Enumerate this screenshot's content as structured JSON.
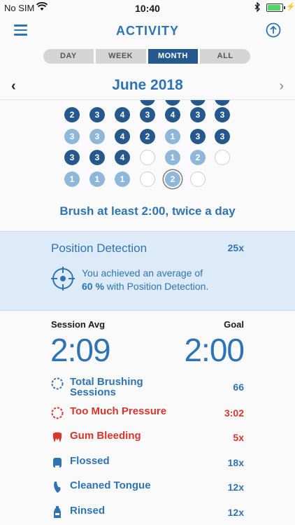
{
  "status": {
    "carrier": "No SIM",
    "time": "10:40"
  },
  "header": {
    "title": "ACTIVITY"
  },
  "segments": [
    {
      "label": "DAY",
      "active": false
    },
    {
      "label": "WEEK",
      "active": false
    },
    {
      "label": "MONTH",
      "active": true
    },
    {
      "label": "ALL",
      "active": false
    }
  ],
  "month": {
    "label": "June 2018",
    "prev": "‹",
    "next": "›"
  },
  "calendar": {
    "rows": [
      [
        {
          "v": "2",
          "s": "dark"
        },
        {
          "v": "3",
          "s": "dark"
        },
        {
          "v": "4",
          "s": "dark"
        },
        {
          "v": "3",
          "s": "dark"
        },
        {
          "v": "4",
          "s": "dark"
        },
        {
          "v": "3",
          "s": "dark"
        },
        {
          "v": "3",
          "s": "dark"
        }
      ],
      [
        {
          "v": "3",
          "s": "light"
        },
        {
          "v": "3",
          "s": "light"
        },
        {
          "v": "4",
          "s": "dark"
        },
        {
          "v": "2",
          "s": "dark"
        },
        {
          "v": "1",
          "s": "light"
        },
        {
          "v": "3",
          "s": "dark"
        },
        {
          "v": "3",
          "s": "dark"
        }
      ],
      [
        {
          "v": "3",
          "s": "dark"
        },
        {
          "v": "3",
          "s": "dark"
        },
        {
          "v": "4",
          "s": "dark"
        },
        {
          "v": "",
          "s": "empty"
        },
        {
          "v": "1",
          "s": "light"
        },
        {
          "v": "2",
          "s": "light"
        },
        {
          "v": "",
          "s": "empty"
        }
      ],
      [
        {
          "v": "1",
          "s": "light"
        },
        {
          "v": "1",
          "s": "light"
        },
        {
          "v": "1",
          "s": "light"
        },
        {
          "v": "",
          "s": "empty"
        },
        {
          "v": "2",
          "s": "light",
          "today": true
        },
        {
          "v": "",
          "s": "empty"
        }
      ]
    ]
  },
  "goal_text": "Brush at least 2:00, twice a day",
  "position": {
    "title": "Position Detection",
    "count": "25x",
    "msg_line1": "You achieved an average of",
    "msg_percent": "60 %",
    "msg_line2": " with Position Detection."
  },
  "stats": {
    "avg_label": "Session Avg",
    "goal_label": "Goal",
    "avg_time": "2:09",
    "goal_time": "2:00"
  },
  "rows": [
    {
      "icon": "dashed-circle-icon",
      "label1": "Total Brushing",
      "label2": "Sessions",
      "value": "66",
      "red": false
    },
    {
      "icon": "pressure-circle-icon",
      "label1": "Too Much Pressure",
      "label2": "",
      "value": "3:02",
      "red": true
    },
    {
      "icon": "tooth-drop-icon",
      "label1": "Gum Bleeding",
      "label2": "",
      "value": "5x",
      "red": true
    },
    {
      "icon": "floss-icon",
      "label1": "Flossed",
      "label2": "",
      "value": "18x",
      "red": false
    },
    {
      "icon": "tongue-icon",
      "label1": "Cleaned Tongue",
      "label2": "",
      "value": "12x",
      "red": false
    },
    {
      "icon": "mouthwash-icon",
      "label1": "Rinsed",
      "label2": "",
      "value": "12x",
      "red": false
    }
  ],
  "colors": {
    "primary": "#2e74b5",
    "dark": "#25598d",
    "light": "#8fb7da",
    "alert": "#d9362b",
    "panel": "#dcebf7"
  }
}
